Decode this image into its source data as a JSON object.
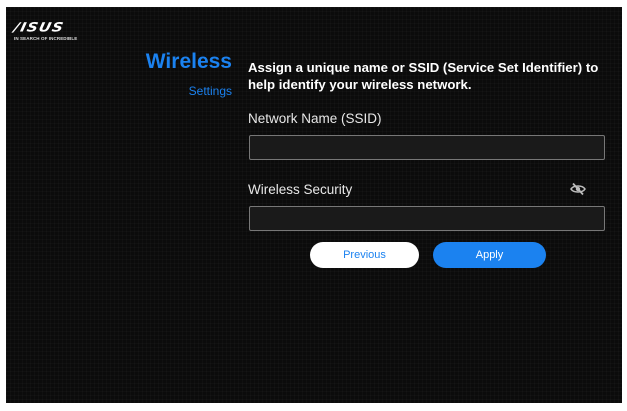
{
  "brand": {
    "logo": "/ISUS",
    "tagline": "IN SEARCH OF INCREDIBLE"
  },
  "sidebar": {
    "title": "Wireless",
    "subtitle": "Settings"
  },
  "description": "Assign a unique name or SSID (Service Set Identifier) to help identify your wireless network.",
  "form": {
    "ssid": {
      "label": "Network Name (SSID)",
      "value": "",
      "placeholder": ""
    },
    "security": {
      "label": "Wireless Security",
      "value": "",
      "placeholder": "",
      "visibility_icon": "eye-slash-icon"
    }
  },
  "buttons": {
    "previous": "Previous",
    "apply": "Apply"
  },
  "colors": {
    "accent": "#1b82f0",
    "background": "#0b0b0b",
    "field_border": "#777777"
  }
}
